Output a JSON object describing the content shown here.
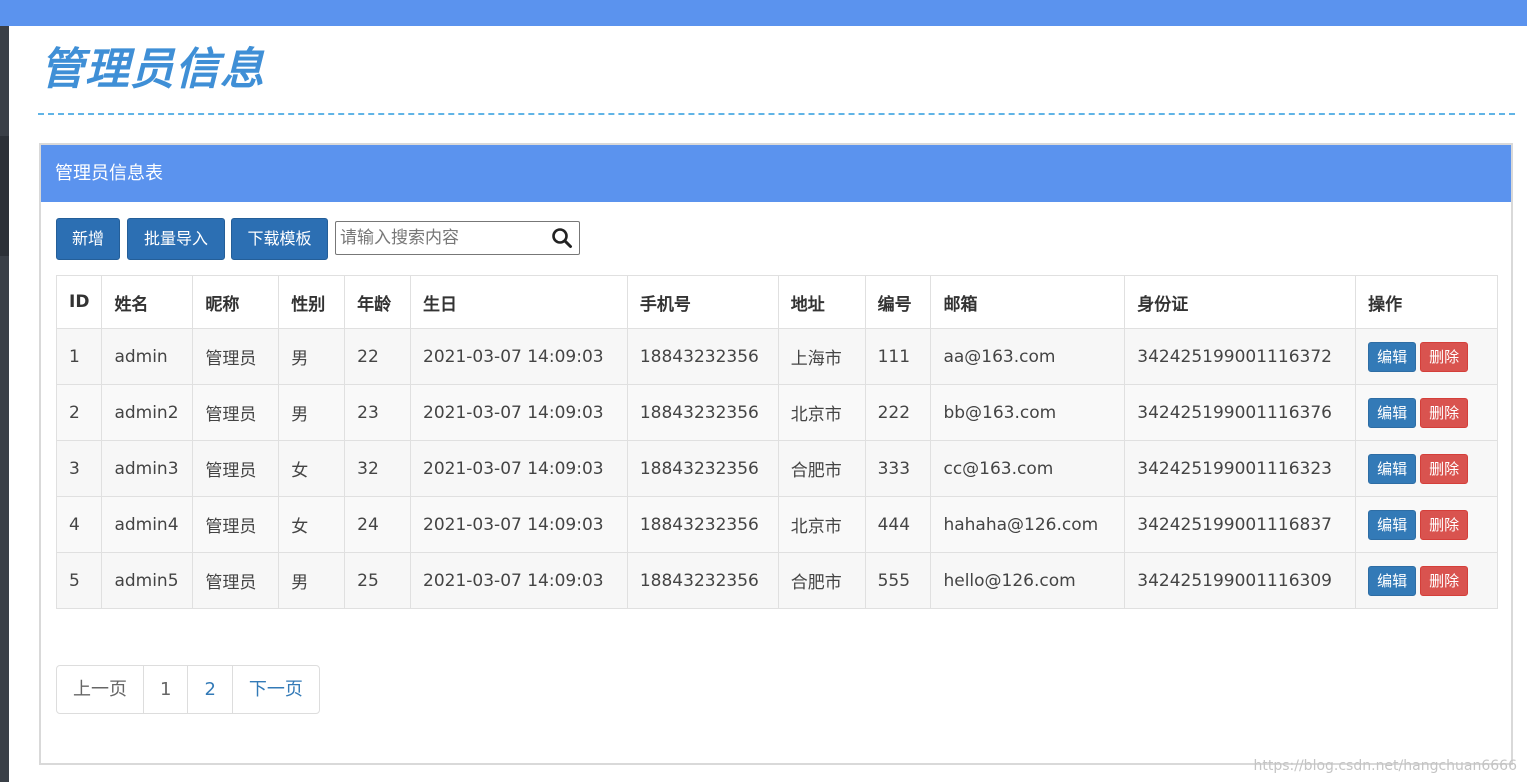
{
  "title": "管理员信息",
  "panel": {
    "heading": "管理员信息表"
  },
  "toolbar": {
    "add_label": "新增",
    "import_label": "批量导入",
    "template_label": "下载模板",
    "search_placeholder": "请输入搜索内容",
    "search_icon": "search-icon"
  },
  "table": {
    "headers": [
      "ID",
      "姓名",
      "昵称",
      "性别",
      "年龄",
      "生日",
      "手机号",
      "地址",
      "编号",
      "邮箱",
      "身份证",
      "操作"
    ],
    "edit_label": "编辑",
    "delete_label": "删除",
    "rows": [
      [
        "1",
        "admin",
        "管理员",
        "男",
        "22",
        "2021-03-07 14:09:03",
        "18843232356",
        "上海市",
        "111",
        "aa@163.com",
        "342425199001116372"
      ],
      [
        "2",
        "admin2",
        "管理员",
        "男",
        "23",
        "2021-03-07 14:09:03",
        "18843232356",
        "北京市",
        "222",
        "bb@163.com",
        "342425199001116376"
      ],
      [
        "3",
        "admin3",
        "管理员",
        "女",
        "32",
        "2021-03-07 14:09:03",
        "18843232356",
        "合肥市",
        "333",
        "cc@163.com",
        "342425199001116323"
      ],
      [
        "4",
        "admin4",
        "管理员",
        "女",
        "24",
        "2021-03-07 14:09:03",
        "18843232356",
        "北京市",
        "444",
        "hahaha@126.com",
        "342425199001116837"
      ],
      [
        "5",
        "admin5",
        "管理员",
        "男",
        "25",
        "2021-03-07 14:09:03",
        "18843232356",
        "合肥市",
        "555",
        "hello@126.com",
        "342425199001116309"
      ]
    ]
  },
  "pagination": {
    "prev": "上一页",
    "pages": [
      "1",
      "2"
    ],
    "next": "下一页"
  },
  "watermark": "https://blog.csdn.net/hangchuan6666",
  "colors": {
    "topbar": "#5b93ee",
    "title": "#3f8fd6",
    "primary_button": "#2c6fb3",
    "edit": "#337ab7",
    "delete": "#d9534f"
  }
}
